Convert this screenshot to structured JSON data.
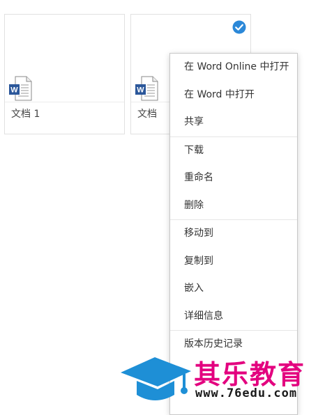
{
  "files": [
    {
      "name": "文档 1",
      "selected": false,
      "icon": "word-doc-icon"
    },
    {
      "name": "文档",
      "selected": true,
      "icon": "word-doc-icon"
    }
  ],
  "context_menu": {
    "groups": [
      {
        "items": [
          {
            "label": "在 Word Online 中打开"
          },
          {
            "label": "在 Word 中打开"
          },
          {
            "label": "共享"
          }
        ]
      },
      {
        "items": [
          {
            "label": "下载"
          },
          {
            "label": "重命名"
          },
          {
            "label": "删除"
          }
        ]
      },
      {
        "items": [
          {
            "label": "移动到"
          },
          {
            "label": "复制到"
          },
          {
            "label": "嵌入"
          },
          {
            "label": "详细信息"
          }
        ]
      },
      {
        "items": [
          {
            "label": "版本历史记录"
          }
        ]
      }
    ]
  },
  "watermark": {
    "brand": "其乐教育",
    "url": "www.76edu.com"
  },
  "colors": {
    "word_blue": "#2b579a",
    "check_blue": "#2b88d8",
    "brand_pink": "#e3007f",
    "cap_blue": "#1e8fd6"
  }
}
